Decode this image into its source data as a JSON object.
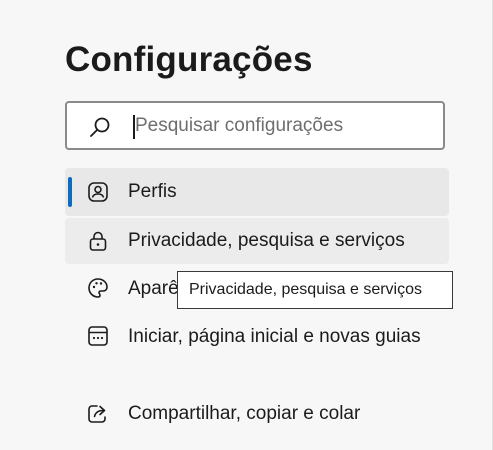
{
  "page": {
    "title": "Configurações"
  },
  "search": {
    "placeholder": "Pesquisar configurações",
    "icon": "search-icon"
  },
  "nav": {
    "items": [
      {
        "label": "Perfis",
        "icon": "profile-icon",
        "state": "selected"
      },
      {
        "label": "Privacidade, pesquisa e serviços",
        "icon": "lock-icon",
        "state": "hovered"
      },
      {
        "label": "Aparência",
        "icon": "palette-icon",
        "state": "normal"
      },
      {
        "label": "Iniciar, página inicial e novas guias",
        "icon": "home-grid-icon",
        "state": "normal"
      },
      {
        "label": "Compartilhar, copiar e colar",
        "icon": "share-icon",
        "state": "normal"
      }
    ]
  },
  "tooltip": {
    "text": "Privacidade, pesquisa e serviços"
  },
  "colors": {
    "background": "#f7f7f7",
    "accent": "#0f6cbd",
    "selected_bg": "#e8e8e8",
    "text": "#1b1b1b"
  }
}
